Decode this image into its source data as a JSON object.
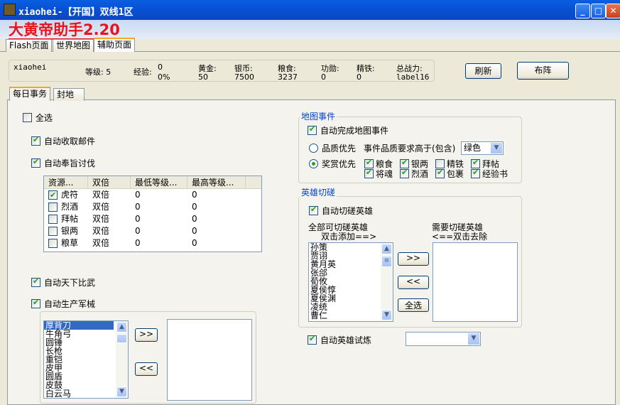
{
  "window": {
    "title": "xiaohei-【开国】双线1区",
    "buttons": [
      "_",
      "□",
      "✕"
    ]
  },
  "brand": "大黄帝助手2.20",
  "main_tabs": [
    "Flash页面",
    "世界地图",
    "辅助页面"
  ],
  "info": {
    "name": "xiaohei",
    "level_label": "等级:",
    "level": "5",
    "exp_label": "经验:",
    "exp": "0",
    "exp_pct": "0%",
    "gold_label": "黄金:",
    "gold": "50",
    "silver_label": "银币:",
    "silver": "7500",
    "food_label": "粮食:",
    "food": "3237",
    "merit_label": "功勋:",
    "merit": "0",
    "iron_label": "精铁:",
    "iron": "0",
    "power_label": "总战力:",
    "power": "label16",
    "refresh": "刷新",
    "formation": "布阵"
  },
  "sub_tabs": [
    "每日事务",
    "封地"
  ],
  "left": {
    "select_all": {
      "label": "全选",
      "checked": false
    },
    "auto_mail": {
      "label": "自动收取邮件",
      "checked": true
    },
    "auto_crusade": {
      "label": "自动奉旨讨伐",
      "checked": true
    },
    "table": {
      "columns": [
        "资源...",
        "双倍",
        "最低等级...",
        "最高等级..."
      ],
      "rows": [
        {
          "checked": true,
          "res": "虎符",
          "dbl": "双倍",
          "min": "0",
          "max": "0"
        },
        {
          "checked": false,
          "res": "烈酒",
          "dbl": "双倍",
          "min": "0",
          "max": "0"
        },
        {
          "checked": false,
          "res": "拜帖",
          "dbl": "双倍",
          "min": "0",
          "max": "0"
        },
        {
          "checked": false,
          "res": "银两",
          "dbl": "双倍",
          "min": "0",
          "max": "0"
        },
        {
          "checked": false,
          "res": "粮草",
          "dbl": "双倍",
          "min": "0",
          "max": "0"
        }
      ]
    },
    "auto_duel": {
      "label": "自动天下比武",
      "checked": true
    },
    "auto_produce": {
      "label": "自动生产军械",
      "checked": true
    },
    "weapons": [
      "厚背刀",
      "牛角弓",
      "圆锤",
      "长枪",
      "重铠",
      "皮甲",
      "圆盾",
      "皮鼓",
      "白云马"
    ],
    "add": ">>",
    "remove": "<<"
  },
  "map_events": {
    "title": "地图事件",
    "auto": {
      "label": "自动完成地图事件",
      "checked": true
    },
    "quality_first": "品质优先",
    "quality_req": "事件品质要求高于(包含)",
    "quality_value": "绿色",
    "reward_first": "奖赏优先",
    "mode": "reward",
    "rewards": [
      {
        "label": "粮食",
        "checked": true
      },
      {
        "label": "银两",
        "checked": true
      },
      {
        "label": "精铁",
        "checked": false
      },
      {
        "label": "拜帖",
        "checked": true
      },
      {
        "label": "将魂",
        "checked": true
      },
      {
        "label": "烈酒",
        "checked": true
      },
      {
        "label": "包裹",
        "checked": true
      },
      {
        "label": "经验书",
        "checked": true
      }
    ]
  },
  "hero_spar": {
    "title": "英雄切磋",
    "auto": {
      "label": "自动切磋英雄",
      "checked": true
    },
    "all_label": "全部可切磋英雄",
    "all_hint": "双击添加==>",
    "need_label": "需要切磋英雄",
    "need_hint": "<==双击去除",
    "heroes": [
      "孙策",
      "贾诩",
      "黄月英",
      "张郃",
      "荀攸",
      "夏侯惇",
      "夏侯渊",
      "凌统",
      "曹仁"
    ],
    "add": ">>",
    "remove": "<<",
    "select_all": "全选"
  },
  "hero_trial": {
    "label": "自动英雄试炼",
    "checked": true,
    "value": ""
  }
}
